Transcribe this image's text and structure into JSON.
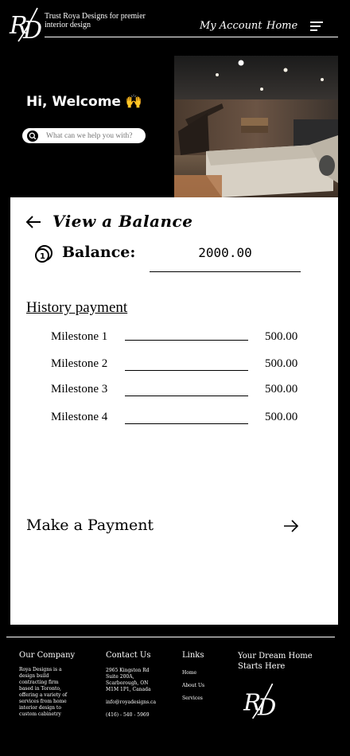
{
  "header": {
    "tagline": "Trust Roya Designs for premier interior design",
    "nav": {
      "account": "My Account",
      "home": "Home"
    }
  },
  "hero": {
    "welcome": "Hi, Welcome 🙌",
    "search_placeholder": "What can we help you with?"
  },
  "panel": {
    "title": "View a Balance",
    "balance_label": "Balance:",
    "balance_value": "2000.00",
    "history_title": "History payment",
    "milestones": [
      {
        "label": "Milestone 1",
        "amount": "500.00"
      },
      {
        "label": "Milestone 2",
        "amount": "500.00"
      },
      {
        "label": "Milestone 3",
        "amount": "500.00"
      },
      {
        "label": "Milestone 4",
        "amount": "500.00"
      }
    ],
    "pay_label": "Make a Payment"
  },
  "footer": {
    "company": {
      "heading": "Our Company",
      "lines": [
        "Roya Designs is a",
        "design build",
        "contracting firm",
        "based in Toronto,",
        "offering a variety of",
        "services from home",
        "interior design to",
        "custom cabinetry"
      ]
    },
    "contact": {
      "heading": "Contact Us",
      "address": [
        "2965 Kingston Rd",
        "Suite 200A,",
        "Scarborough, ON",
        "M1M 1P1, Canada"
      ],
      "email": "info@royadesigns.ca",
      "phone": "(416) - 540 - 5969"
    },
    "links": {
      "heading": "Links",
      "items": [
        "Home",
        "About Us",
        "Services"
      ]
    },
    "dream": "Your Dream Home Starts Here"
  },
  "colors": {
    "background": "#000000",
    "panel": "#ffffff",
    "text_dark": "#000000"
  },
  "icons": [
    "logo",
    "menu-icon",
    "search-icon",
    "back-arrow-icon",
    "coin-icon",
    "right-arrow-icon"
  ]
}
